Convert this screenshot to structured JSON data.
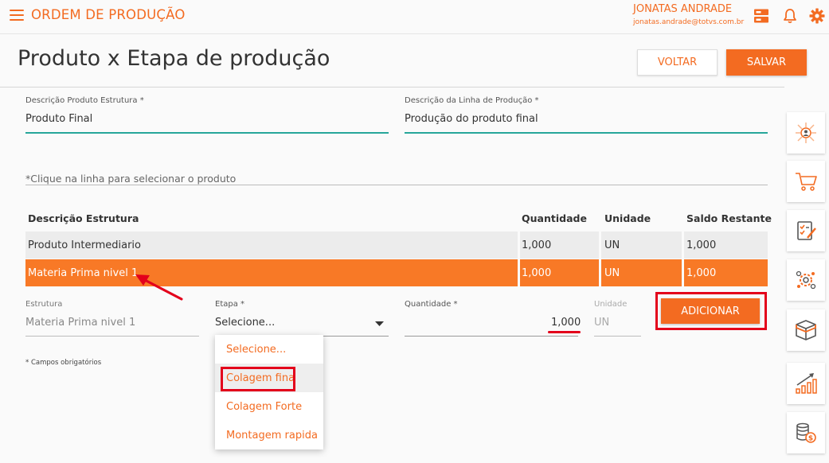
{
  "app": {
    "title": "ORDEM DE PRODUÇÃO"
  },
  "user": {
    "name": "JONATAS ANDRADE",
    "email": "jonatas.andrade@totvs.com.br"
  },
  "page": {
    "title": "Produto x Etapa de produção"
  },
  "actions": {
    "voltar": "VOLTAR",
    "salvar": "SALVAR"
  },
  "form": {
    "produto_label": "Descrição Produto Estrutura *",
    "produto_value": "Produto Final",
    "linha_label": "Descrição da Linha de Produção *",
    "linha_value": "Produção do produto final",
    "hint": "*Clique na linha para selecionar o produto"
  },
  "table": {
    "headers": [
      "Descrição Estrutura",
      "Quantidade",
      "Unidade",
      "Saldo Restante"
    ],
    "rows": [
      [
        "Produto Intermediario",
        "1,000",
        "UN",
        "1,000"
      ],
      [
        "Materia Prima nivel 1",
        "1,000",
        "UN",
        "1,000"
      ]
    ]
  },
  "add": {
    "estrutura_label": "Estrutura",
    "estrutura_value": "Materia Prima nivel 1",
    "etapa_label": "Etapa *",
    "etapa_value": "Selecione...",
    "quantidade_label": "Quantidade *",
    "quantidade_value": "1,000",
    "unidade_label": "Unidade",
    "unidade_value": "UN",
    "button": "ADICIONAR",
    "required_note": "* Campos obrigatórios"
  },
  "dropdown": {
    "options": [
      "Selecione...",
      "Colagem fina",
      "Colagem Forte",
      "Montagem rapida"
    ]
  },
  "sidebar": {
    "icons": [
      "process-icon",
      "cart-icon",
      "checklist-icon",
      "gears-icon",
      "box-icon",
      "growth-chart-icon",
      "coins-icon"
    ]
  },
  "colors": {
    "accent": "#f36b21",
    "highlight_row": "#f87926",
    "field_underline": "#26a69a",
    "annotation": "#e3001b"
  }
}
